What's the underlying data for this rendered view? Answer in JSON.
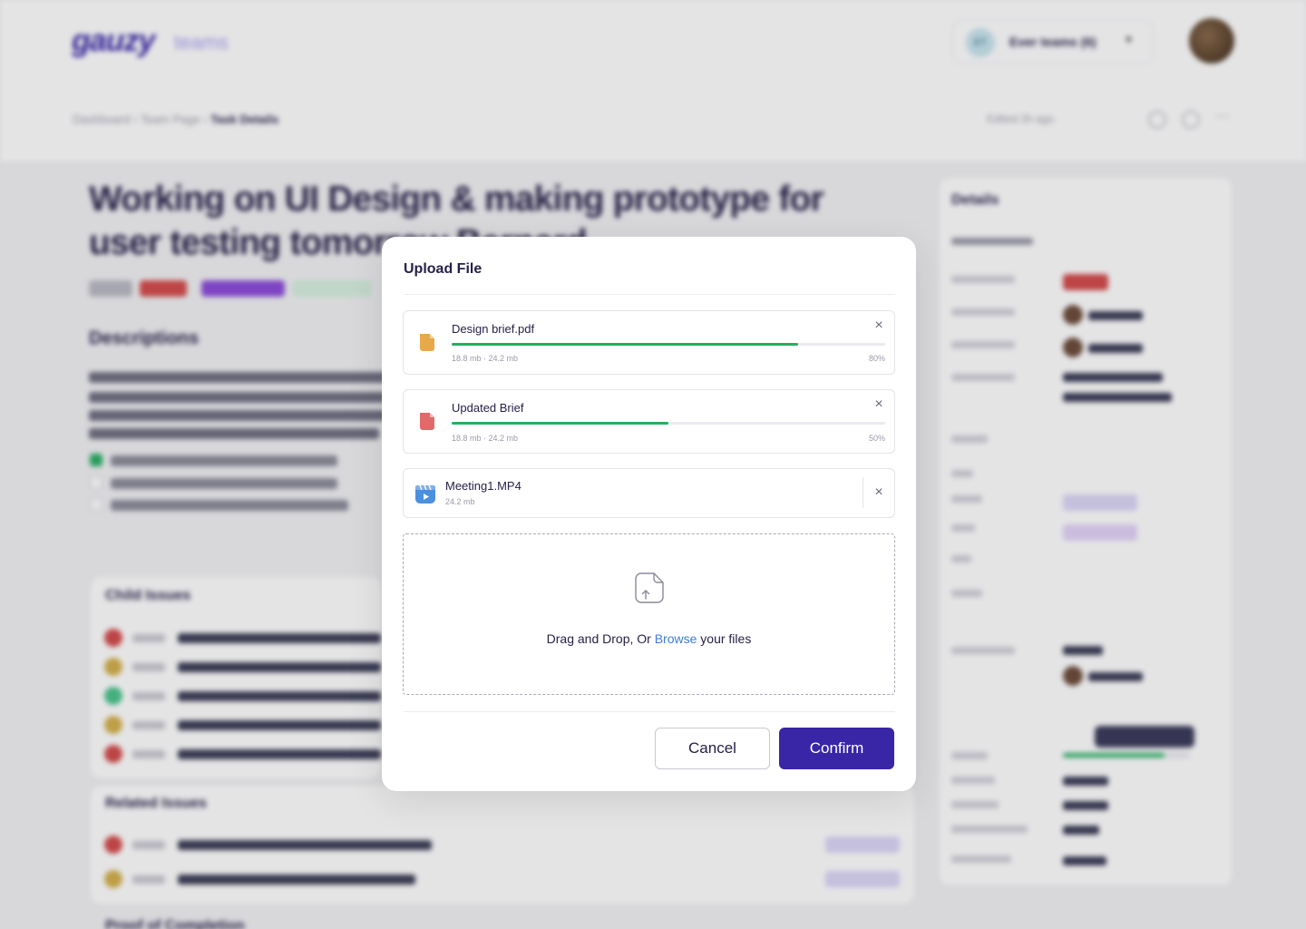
{
  "header": {
    "logo_main": "gauzy",
    "logo_sub": "teams",
    "team_initials": "ET",
    "team_name": "Ever teams (6)"
  },
  "breadcrumb": {
    "items": [
      "Dashboard",
      "Team Page"
    ],
    "current": "Task Details",
    "edited": "Edited 2h ago"
  },
  "task": {
    "title": "Working on UI Design & making prototype for user testing tomorrow Bernard",
    "description_heading": "Descriptions"
  },
  "sections": {
    "child_issues": "Child Issues",
    "related_issues": "Related Issues",
    "proof": "Proof of Completion"
  },
  "details": {
    "title": "Details"
  },
  "modal": {
    "title": "Upload File",
    "files": [
      {
        "name": "Design brief.pdf",
        "size": "18.8 mb  ·  24.2 mb",
        "percent_label": "80%",
        "progress": 0.8,
        "color": "#e8a94a",
        "icon": "document-icon"
      },
      {
        "name": "Updated Brief",
        "size": "18.8 mb  ·  24.2 mb",
        "percent_label": "50%",
        "progress": 0.5,
        "color": "#e06a6a",
        "icon": "document-icon"
      },
      {
        "name": "Meeting1.MP4",
        "size": "24.2 mb",
        "color": "#4a8fe0",
        "icon": "video-file-icon"
      }
    ],
    "dropzone": {
      "text_before": "Drag and Drop, Or ",
      "link": "Browse",
      "text_after": " your files"
    },
    "cancel_label": "Cancel",
    "confirm_label": "Confirm"
  },
  "colors": {
    "accent": "#3826a6",
    "progress": "#27ae60",
    "link": "#3b7dd8"
  }
}
